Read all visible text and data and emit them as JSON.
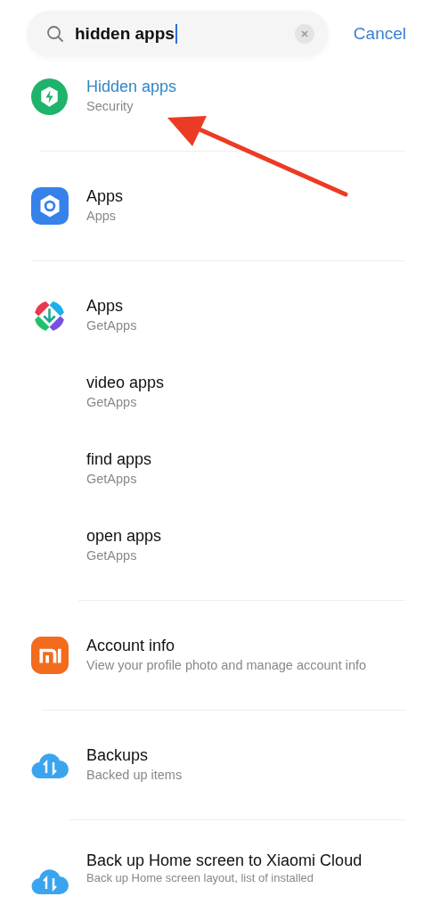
{
  "search": {
    "value": "hidden apps",
    "cancel": "Cancel"
  },
  "annotation": {
    "kind": "arrow"
  },
  "groups": [
    {
      "items": [
        {
          "title": "Hidden apps",
          "subtitle": "Security",
          "highlighted": true,
          "kind": "shield"
        }
      ]
    },
    {
      "items": [
        {
          "title": "Apps",
          "subtitle": "Apps",
          "highlighted": false,
          "kind": "gear"
        }
      ]
    },
    {
      "items": [
        {
          "title": "Apps",
          "subtitle": "GetApps",
          "highlighted": false,
          "kind": "getapps"
        },
        {
          "title": "video apps",
          "subtitle": "GetApps",
          "highlighted": false
        },
        {
          "title": "find apps",
          "subtitle": "GetApps",
          "highlighted": false
        },
        {
          "title": "open apps",
          "subtitle": "GetApps",
          "highlighted": false
        }
      ]
    },
    {
      "items": [
        {
          "title": "Account info",
          "subtitle": "View your profile photo and manage account info",
          "highlighted": false,
          "kind": "mi"
        }
      ]
    },
    {
      "items": [
        {
          "title": "Backups",
          "subtitle": "Backed up items",
          "highlighted": false,
          "kind": "cloud"
        }
      ]
    },
    {
      "items": [
        {
          "title": "Back up Home screen to Xiaomi Cloud",
          "subtitle": "Back up Home screen layout, list of installed",
          "highlighted": false,
          "kind": "cloud"
        }
      ]
    }
  ]
}
